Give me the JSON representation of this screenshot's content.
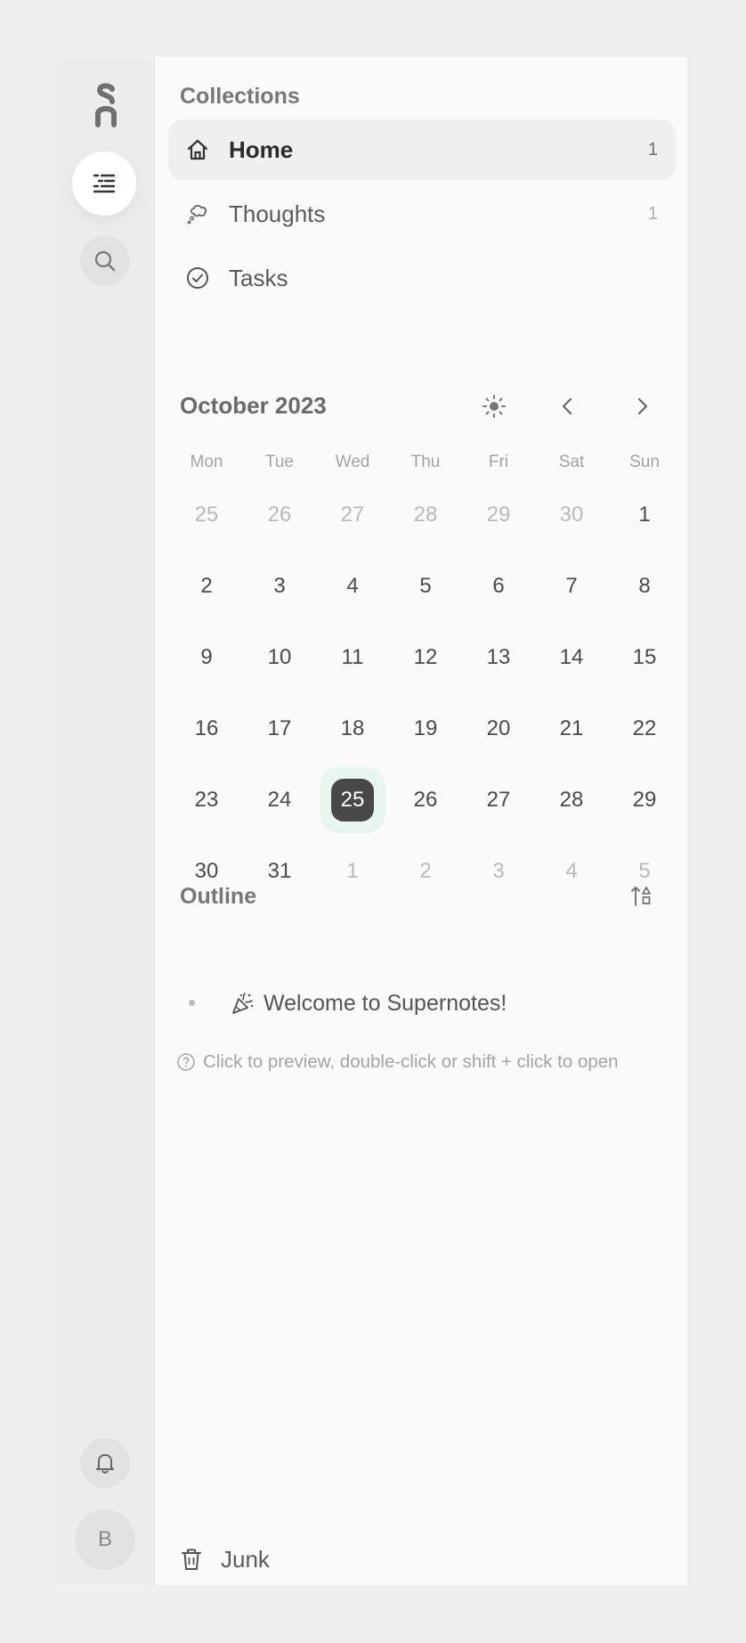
{
  "rail": {
    "avatar_initial": "B",
    "icons": [
      "logo-icon",
      "list-icon",
      "search-icon",
      "bell-icon"
    ]
  },
  "collections": {
    "title": "Collections",
    "items": [
      {
        "label": "Home",
        "count": "1",
        "icon": "home-icon",
        "active": true
      },
      {
        "label": "Thoughts",
        "count": "1",
        "icon": "thought-bubble-icon",
        "active": false
      },
      {
        "label": "Tasks",
        "count": "",
        "icon": "check-circle-icon",
        "active": false
      }
    ]
  },
  "calendar": {
    "month_label": "October 2023",
    "weekdays": [
      "Mon",
      "Tue",
      "Wed",
      "Thu",
      "Fri",
      "Sat",
      "Sun"
    ],
    "weeks": [
      [
        "25",
        "26",
        "27",
        "28",
        "29",
        "30",
        "1"
      ],
      [
        "2",
        "3",
        "4",
        "5",
        "6",
        "7",
        "8"
      ],
      [
        "9",
        "10",
        "11",
        "12",
        "13",
        "14",
        "15"
      ],
      [
        "16",
        "17",
        "18",
        "19",
        "20",
        "21",
        "22"
      ],
      [
        "23",
        "24",
        "25",
        "26",
        "27",
        "28",
        "29"
      ],
      [
        "30",
        "31",
        "1",
        "2",
        "3",
        "4",
        "5"
      ]
    ],
    "muted_cells": [
      "0-0",
      "0-1",
      "0-2",
      "0-3",
      "0-4",
      "0-5",
      "5-2",
      "5-3",
      "5-4",
      "5-5",
      "5-6"
    ],
    "today_cell": "4-2"
  },
  "outline": {
    "title": "Outline",
    "items": [
      {
        "label": "Welcome to Supernotes!",
        "icon": "party-popper-icon"
      }
    ],
    "hint": "Click to preview, double-click or shift + click to open"
  },
  "junk": {
    "label": "Junk"
  },
  "colors": {
    "accent_today": "#484848",
    "today_ring": "#e7f6ee"
  }
}
